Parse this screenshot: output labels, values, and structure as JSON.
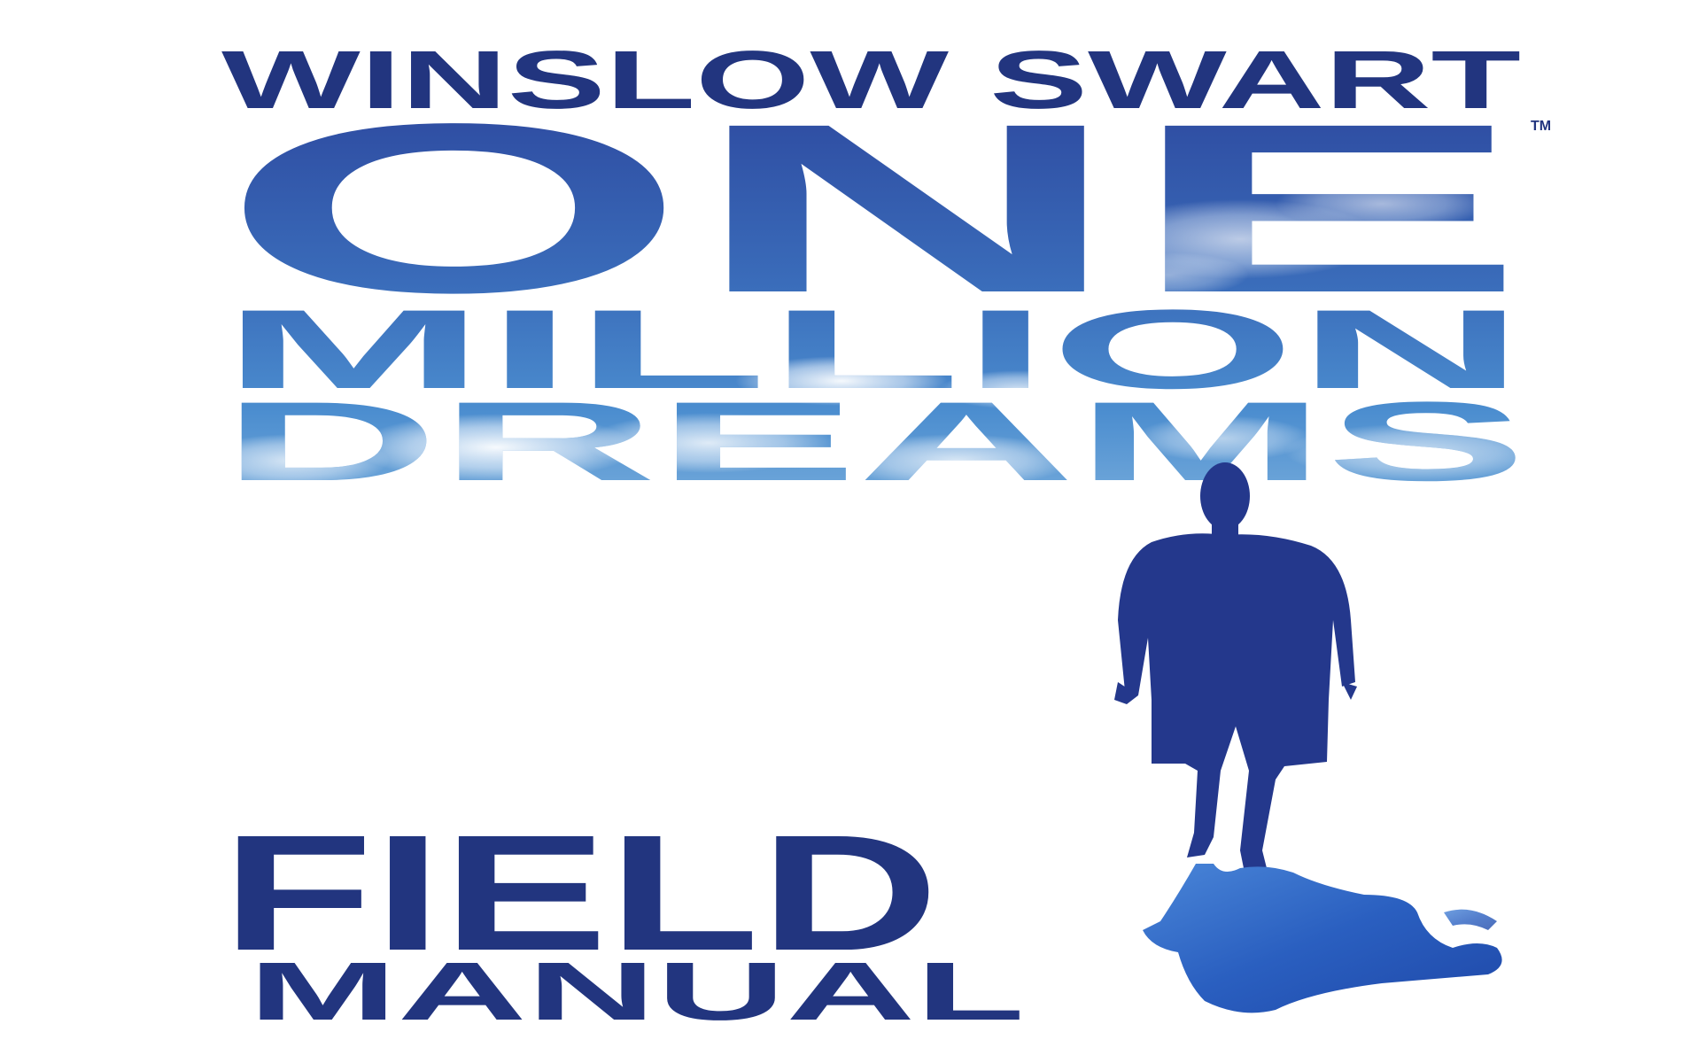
{
  "cover": {
    "author": "WINSLOW SWART",
    "title_line1": "ONE",
    "trademark": "TM",
    "title_line2": "MILLION",
    "title_line3": "DREAMS",
    "subtitle_line1": "FIELD",
    "subtitle_line2": "MANUAL"
  },
  "colors": {
    "navy": "#22357f",
    "sky_top": "#2f4ea3",
    "sky_mid": "#3f7cc4",
    "sky_bottom": "#6aa3d8",
    "silhouette": "#24388c",
    "shadow": "#2a5fc0"
  }
}
